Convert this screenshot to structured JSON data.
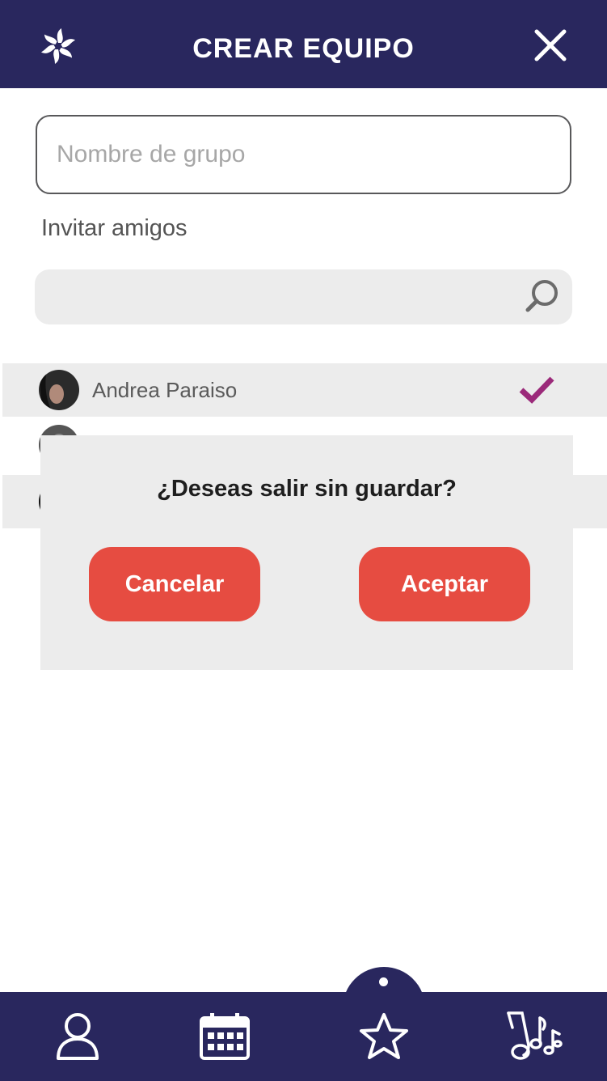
{
  "header": {
    "title": "CREAR EQUIPO",
    "logo_icon": "pinwheel-logo-icon",
    "close_icon": "close-icon"
  },
  "form": {
    "group_name_placeholder": "Nombre de grupo",
    "group_name_value": "",
    "invite_label": "Invitar amigos",
    "search_value": ""
  },
  "friends": [
    {
      "name": "Andrea Paraiso",
      "selected": true
    },
    {
      "name": "",
      "selected": false
    },
    {
      "name": "",
      "selected": false
    }
  ],
  "modal": {
    "title": "¿Deseas salir sin guardar?",
    "cancel_label": "Cancelar",
    "accept_label": "Aceptar"
  },
  "bottom_nav": {
    "items": [
      "profile-icon",
      "calendar-icon",
      "star-icon",
      "music-notes-icon"
    ],
    "active": "star-icon"
  },
  "colors": {
    "navy": "#29275e",
    "accent_red": "#e64c41",
    "check_magenta": "#9b2a7a",
    "row_gray": "#ececec"
  }
}
